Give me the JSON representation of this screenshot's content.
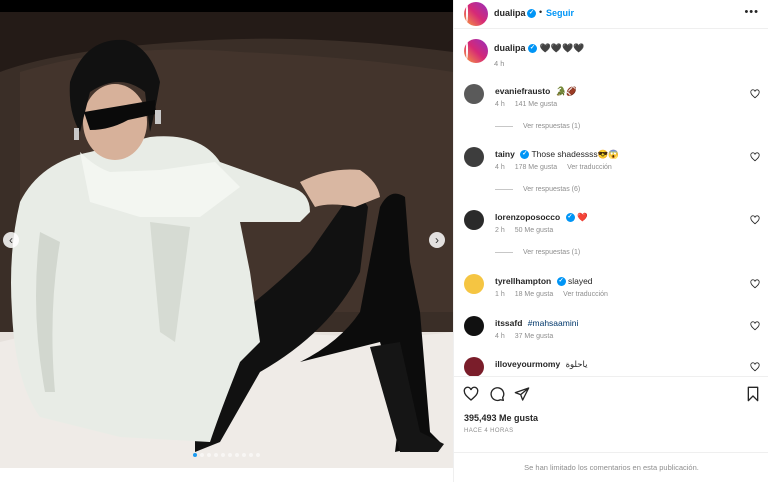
{
  "post": {
    "username": "dualipa",
    "follow_label": "Seguir",
    "separator": "•",
    "more_icon": "more-horizontal-icon",
    "media_slides": 10,
    "active_slide": 1
  },
  "caption": {
    "username": "dualipa",
    "text": "🖤🖤🖤🖤",
    "time": "4 h"
  },
  "comments": [
    {
      "username": "evaniefrausto",
      "text": "🐊🏈",
      "time": "4 h",
      "likes": "141 Me gusta",
      "translate": "",
      "replies": "Ver respuestas (1)",
      "verified": false,
      "avatar_color": "#5a5a5a"
    },
    {
      "username": "tainy",
      "text": "Those shadessss😎😱",
      "time": "4 h",
      "likes": "178 Me gusta",
      "translate": "Ver traducción",
      "replies": "Ver respuestas (6)",
      "verified": true,
      "avatar_color": "#3d3d3d"
    },
    {
      "username": "lorenzoposocco",
      "text": "❤️",
      "time": "2 h",
      "likes": "50 Me gusta",
      "translate": "",
      "replies": "Ver respuestas (1)",
      "verified": true,
      "avatar_color": "#2a2a2a"
    },
    {
      "username": "tyrellhampton",
      "text": "slayed",
      "time": "1 h",
      "likes": "18 Me gusta",
      "translate": "Ver traducción",
      "replies": "",
      "verified": true,
      "avatar_color": "#f5c542"
    },
    {
      "username": "itssafd",
      "text": "#mahsaamini",
      "time": "4 h",
      "likes": "37 Me gusta",
      "translate": "",
      "replies": "",
      "verified": false,
      "avatar_color": "#111111"
    },
    {
      "username": "illoveyourmomy",
      "text": "ياحلوة",
      "time": "",
      "likes": "",
      "translate": "",
      "replies": "",
      "verified": false,
      "avatar_color": "#7a1d2a"
    }
  ],
  "actions": {
    "like_icon": "heart-icon",
    "comment_icon": "comment-icon",
    "share_icon": "share-icon",
    "save_icon": "bookmark-icon",
    "likes_count": "395,493 Me gusta",
    "time_ago": "Hace 4 horas",
    "comments_limited": "Se han limitado los comentarios en esta publicación."
  },
  "colors": {
    "accent": "#0095f6",
    "muted": "#8e8e8e",
    "text": "#262626",
    "slide_dot_active": "#1d9bf0"
  }
}
